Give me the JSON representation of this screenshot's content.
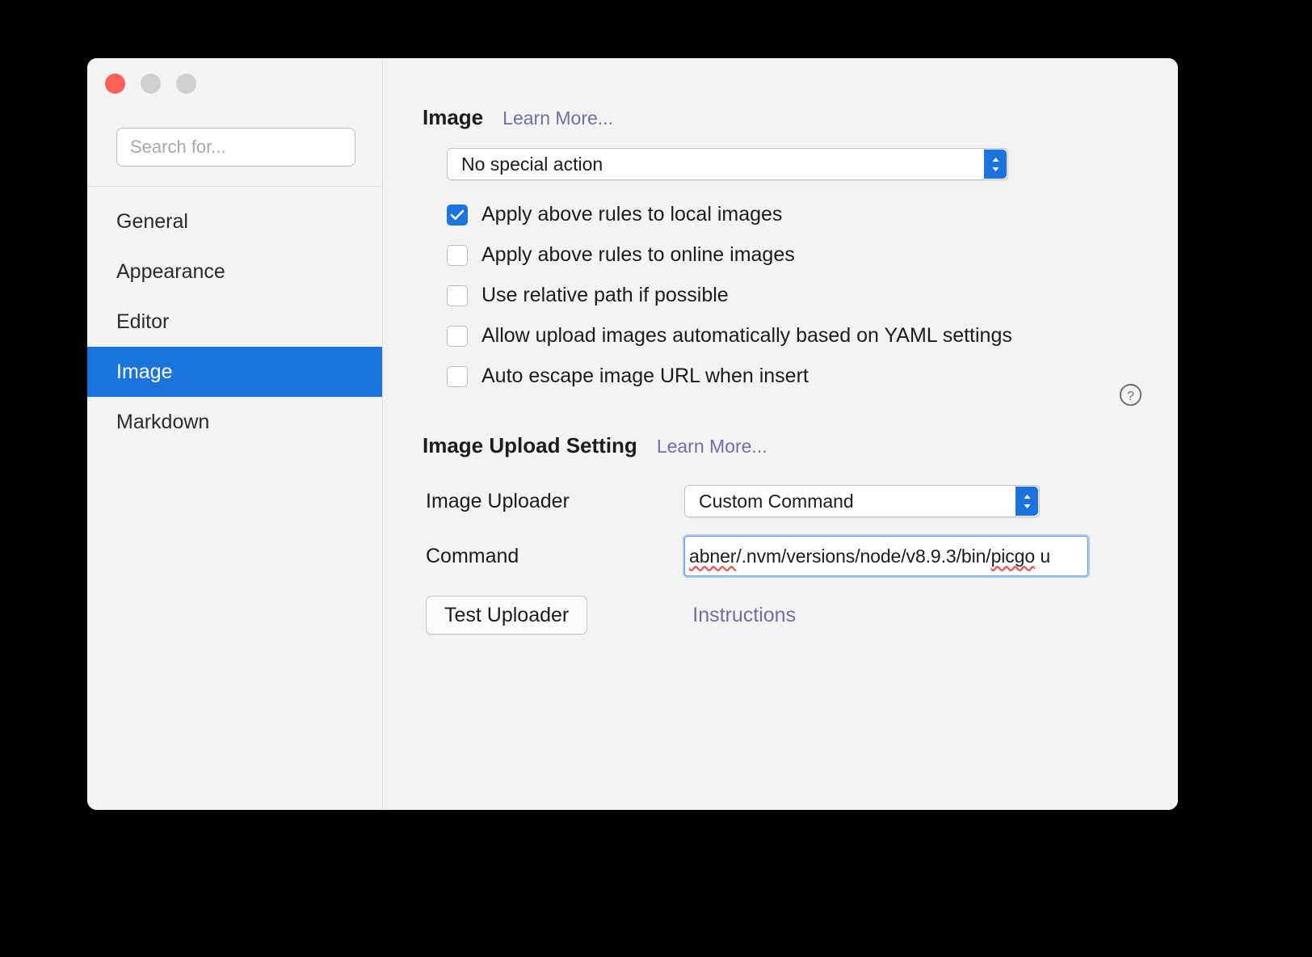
{
  "window": {
    "traffic_lights": [
      "close",
      "minimize",
      "zoom"
    ]
  },
  "sidebar": {
    "search": {
      "placeholder": "Search for...",
      "value": ""
    },
    "items": [
      {
        "label": "General",
        "selected": false
      },
      {
        "label": "Appearance",
        "selected": false
      },
      {
        "label": "Editor",
        "selected": false
      },
      {
        "label": "Image",
        "selected": true
      },
      {
        "label": "Markdown",
        "selected": false
      }
    ]
  },
  "image_section": {
    "title": "Image",
    "learn_more": "Learn More...",
    "action_select": {
      "value": "No special action"
    },
    "checkboxes": [
      {
        "label": "Apply above rules to local images",
        "checked": true
      },
      {
        "label": "Apply above rules to online images",
        "checked": false
      },
      {
        "label": "Use relative path if possible",
        "checked": false
      },
      {
        "label": "Allow upload images automatically based on YAML settings",
        "checked": false
      },
      {
        "label": "Auto escape image URL when insert",
        "checked": false
      }
    ],
    "help_icon": "question-mark-circle-icon"
  },
  "upload_section": {
    "title": "Image Upload Setting",
    "learn_more": "Learn More...",
    "uploader_label": "Image Uploader",
    "uploader_value": "Custom Command",
    "command_label": "Command",
    "command_value": "abner/.nvm/versions/node/v8.9.3/bin/picgo u",
    "command_part_1": "abner",
    "command_part_2": "/.nvm/versions/node/v8.9.3/bin/",
    "command_part_3": "picgo",
    "command_part_4": " u",
    "test_button": "Test Uploader",
    "instructions_link": "Instructions"
  },
  "colors": {
    "accent_blue": "#1a74db",
    "link_purple": "#6f6fa8",
    "close_red": "#fc6058",
    "window_bg": "#f3f3f2",
    "focus_blue": "#5d9cea",
    "spell_red": "#e8534f"
  }
}
